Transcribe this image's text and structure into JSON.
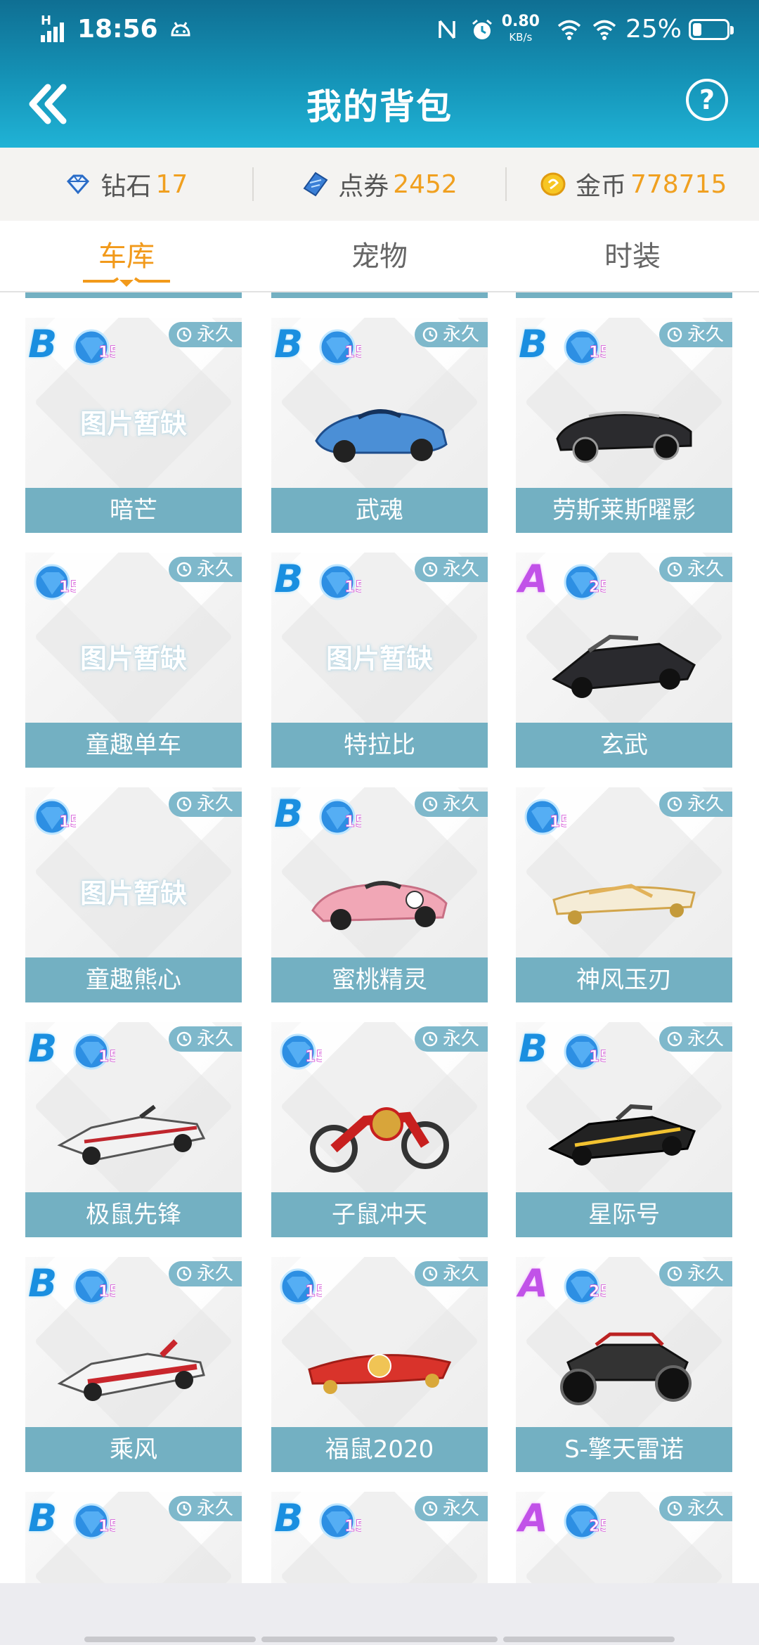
{
  "status_bar": {
    "time": "18:56",
    "net_speed_value": "0.80",
    "net_speed_unit": "KB/s",
    "battery": "25%",
    "battery_level": 0.25,
    "signal_label": "H"
  },
  "header": {
    "title": "我的背包",
    "help_label": "?"
  },
  "currencies": [
    {
      "name": "钻石",
      "amount": "17",
      "icon": "diamond-icon"
    },
    {
      "name": "点券",
      "amount": "2452",
      "icon": "coupon-icon"
    },
    {
      "name": "金币",
      "amount": "778715",
      "icon": "gold-coin-icon"
    }
  ],
  "tabs": [
    {
      "label": "车库",
      "active": true
    },
    {
      "label": "宠物",
      "active": false
    },
    {
      "label": "时装",
      "active": false
    }
  ],
  "placeholder_text": "图片暂缺",
  "items": [
    {
      "name": "暗芒",
      "rank": "B",
      "level": "15",
      "duration": "永久",
      "image": "placeholder"
    },
    {
      "name": "武魂",
      "rank": "B",
      "level": "15",
      "duration": "永久",
      "image": "blue-sports-car"
    },
    {
      "name": "劳斯莱斯曜影",
      "rank": "B",
      "level": "15",
      "duration": "永久",
      "image": "black-convertible"
    },
    {
      "name": "童趣单车",
      "rank": "",
      "level": "15",
      "duration": "永久",
      "image": "placeholder"
    },
    {
      "name": "特拉比",
      "rank": "B",
      "level": "15",
      "duration": "永久",
      "image": "placeholder"
    },
    {
      "name": "玄武",
      "rank": "A",
      "level": "25",
      "duration": "永久",
      "image": "black-racer"
    },
    {
      "name": "童趣熊心",
      "rank": "",
      "level": "15",
      "duration": "永久",
      "image": "placeholder"
    },
    {
      "name": "蜜桃精灵",
      "rank": "B",
      "level": "15",
      "duration": "永久",
      "image": "pink-racer"
    },
    {
      "name": "神风玉刃",
      "rank": "",
      "level": "15",
      "duration": "永久",
      "image": "white-board"
    },
    {
      "name": "极鼠先锋",
      "rank": "B",
      "level": "15",
      "duration": "永久",
      "image": "white-formula"
    },
    {
      "name": "子鼠冲天",
      "rank": "",
      "level": "15",
      "duration": "永久",
      "image": "red-motorbike"
    },
    {
      "name": "星际号",
      "rank": "B",
      "level": "15",
      "duration": "永久",
      "image": "black-yellow-racer"
    },
    {
      "name": "乘风",
      "rank": "B",
      "level": "15",
      "duration": "永久",
      "image": "red-white-formula"
    },
    {
      "name": "福鼠2020",
      "rank": "",
      "level": "15",
      "duration": "永久",
      "image": "red-board"
    },
    {
      "name": "S-擎天雷诺",
      "rank": "A",
      "level": "25",
      "duration": "永久",
      "image": "black-buggy"
    },
    {
      "name": "",
      "rank": "B",
      "level": "15",
      "duration": "永久",
      "image": "partial"
    },
    {
      "name": "",
      "rank": "B",
      "level": "15",
      "duration": "永久",
      "image": "partial"
    },
    {
      "name": "",
      "rank": "A",
      "level": "25",
      "duration": "永久",
      "image": "partial"
    }
  ],
  "colors": {
    "header_top": "#0f6f93",
    "header_bottom": "#20b3d6",
    "accent_orange": "#f29a1b",
    "amount_orange": "#f0a020",
    "card_label_bg": "#73b0c2",
    "tag_bg": "#7eb8cb"
  }
}
